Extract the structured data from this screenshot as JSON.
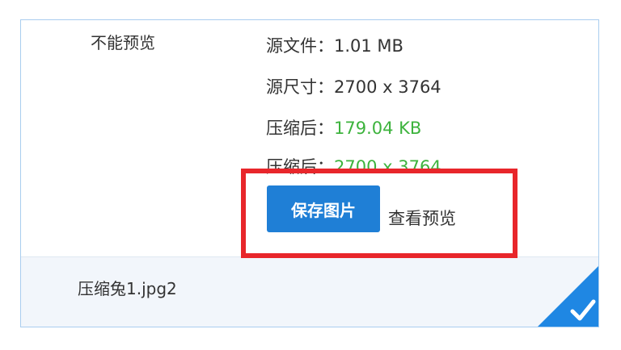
{
  "card": {
    "no_preview_text": "不能预览",
    "info": [
      {
        "label": "源文件：",
        "value": "1.01 MB",
        "highlight": false
      },
      {
        "label": "源尺寸：",
        "value": "2700 x 3764",
        "highlight": false
      },
      {
        "label": "压缩后：",
        "value": "179.04 KB",
        "highlight": true
      },
      {
        "label": "压缩后：",
        "value": "2700 x 3764",
        "highlight": true
      }
    ],
    "actions": {
      "save_label": "保存图片",
      "preview_label": "查看预览"
    },
    "footer": {
      "filename": "压缩兔1.jpg2"
    }
  },
  "colors": {
    "primary_button": "#1f7fd6",
    "success_text": "#3db33d",
    "highlight_border": "#e8262b",
    "card_border": "#a9cdef",
    "check_badge": "#1f87e3"
  },
  "icons": {
    "corner_check": "checkmark-icon"
  }
}
